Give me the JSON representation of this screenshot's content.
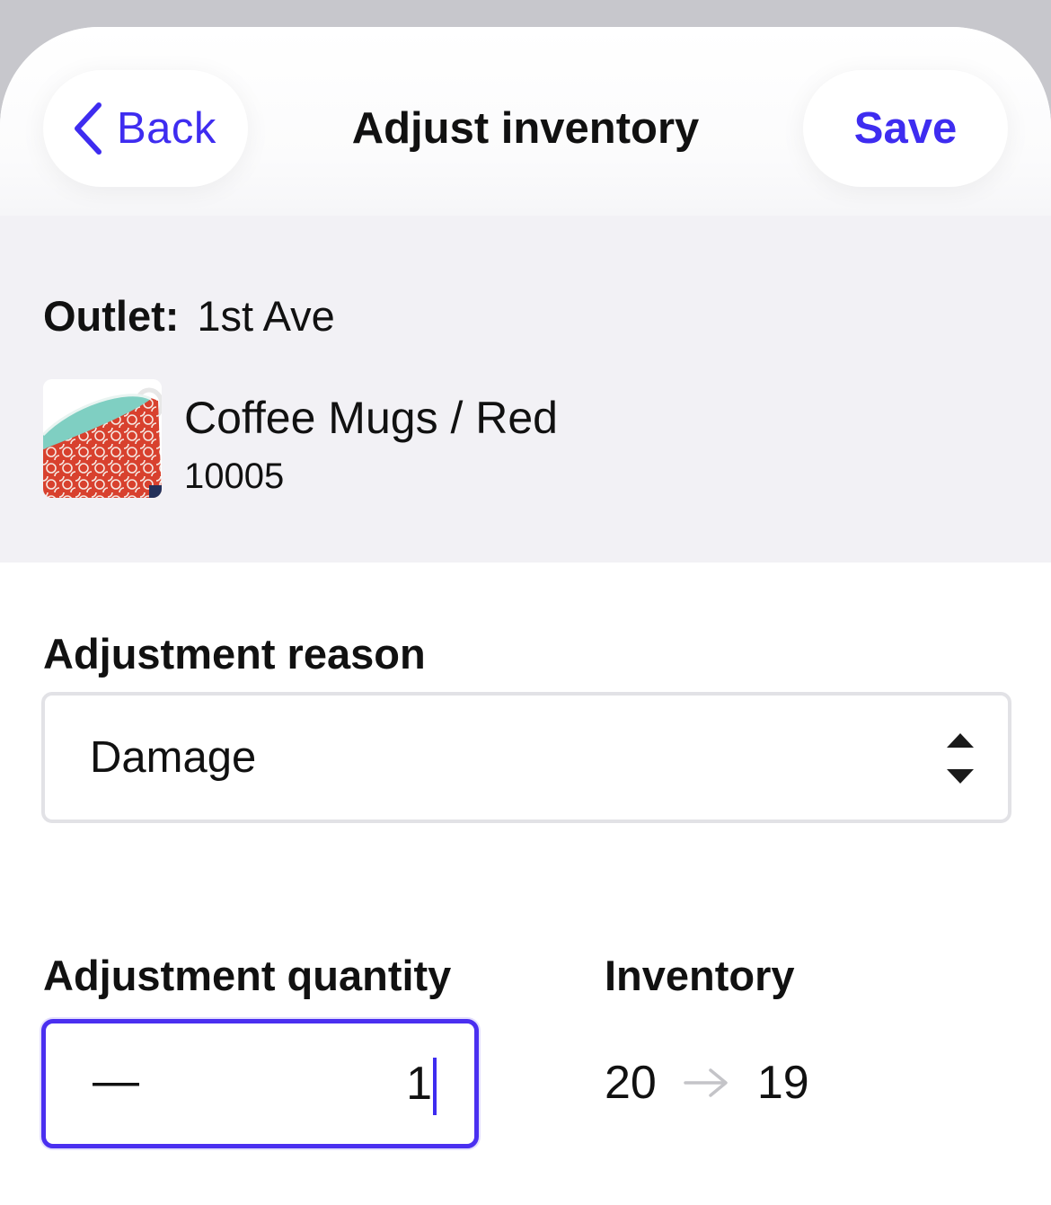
{
  "header": {
    "back_label": "Back",
    "title": "Adjust inventory",
    "save_label": "Save"
  },
  "product": {
    "outlet_label": "Outlet:",
    "outlet_value": "1st Ave",
    "name": "Coffee Mugs / Red",
    "sku": "10005",
    "thumbnail_icon": "red-coffee-mug-image"
  },
  "adjustment_reason": {
    "label": "Adjustment reason",
    "selected": "Damage"
  },
  "adjustment_quantity": {
    "label": "Adjustment quantity",
    "sign": "—",
    "value": "1"
  },
  "inventory": {
    "label": "Inventory",
    "from": "20",
    "to": "19"
  },
  "colors": {
    "accent": "#3e2cf0",
    "panel_background": "#f2f1f5",
    "outer_background": "#c7c7cc"
  }
}
